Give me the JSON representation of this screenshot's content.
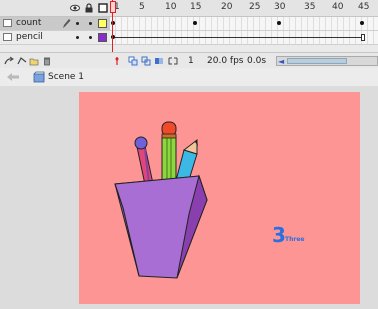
{
  "timeline": {
    "ruler_numbers": [
      "1",
      "5",
      "10",
      "15",
      "20",
      "25",
      "30",
      "35",
      "40",
      "45"
    ],
    "layers": [
      {
        "name": "count",
        "selected": true,
        "color": "#ffff66"
      },
      {
        "name": "pencil",
        "selected": false,
        "color": "#8a2ecb"
      }
    ]
  },
  "footer": {
    "current_frame": "1",
    "fps": "20.0 fps",
    "time": "0.0s"
  },
  "edit_bar": {
    "scene": "Scene 1"
  },
  "stage": {
    "background": "#fd9595",
    "number": "3",
    "word": "Three"
  }
}
